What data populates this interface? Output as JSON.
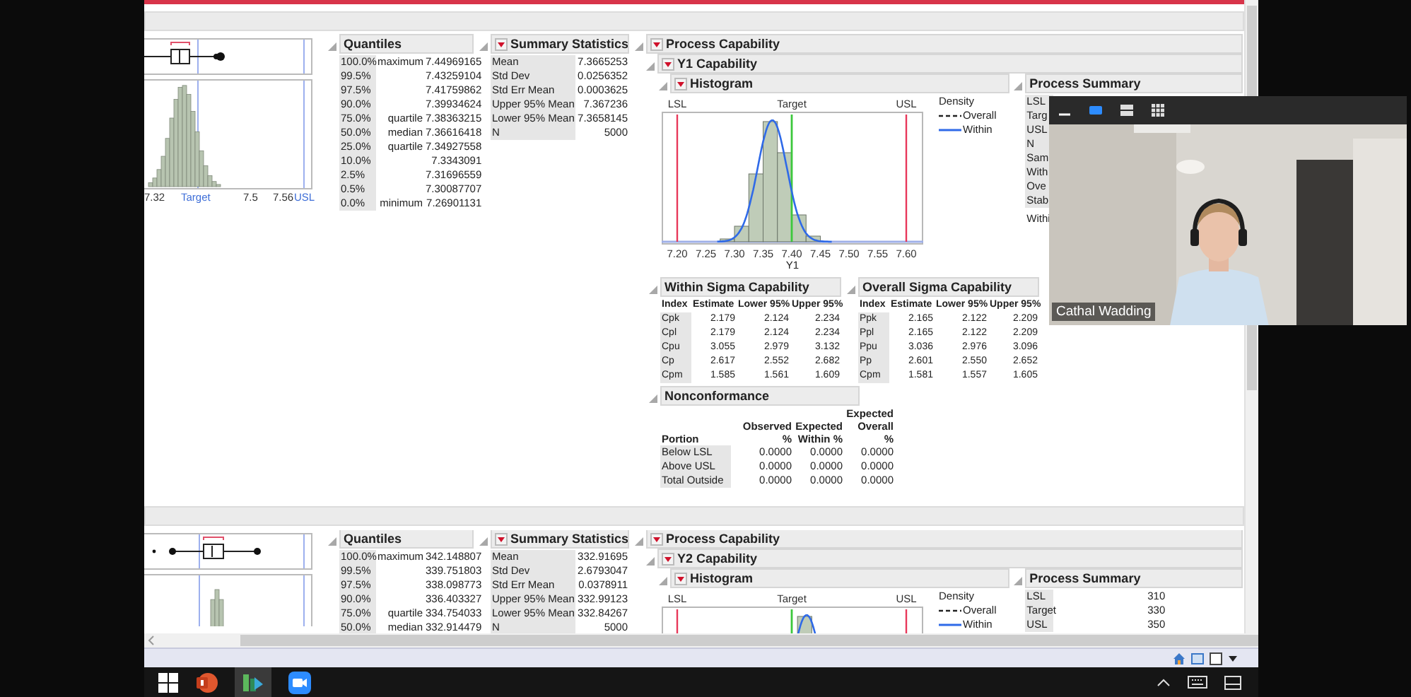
{
  "sections": [
    {
      "plot": {
        "axis_labels": [
          {
            "text": "7.32",
            "kind": "tick"
          },
          {
            "text": "Target",
            "kind": "spec"
          },
          {
            "text": "7.5",
            "kind": "tick"
          },
          {
            "text": "7.56",
            "kind": "tick"
          },
          {
            "text": "USL",
            "kind": "spec"
          }
        ]
      },
      "quantiles": {
        "title": "Quantiles",
        "rows": [
          {
            "percent": "100.0%",
            "label": "maximum",
            "value": "7.44969165"
          },
          {
            "percent": "99.5%",
            "value": "7.43259104"
          },
          {
            "percent": "97.5%",
            "value": "7.41759862"
          },
          {
            "percent": "90.0%",
            "value": "7.39934624"
          },
          {
            "percent": "75.0%",
            "label": "quartile",
            "value": "7.38363215"
          },
          {
            "percent": "50.0%",
            "label": "median",
            "value": "7.36616418"
          },
          {
            "percent": "25.0%",
            "label": "quartile",
            "value": "7.34927558"
          },
          {
            "percent": "10.0%",
            "value": "7.3343091"
          },
          {
            "percent": "2.5%",
            "value": "7.31696559"
          },
          {
            "percent": "0.5%",
            "value": "7.30087707"
          },
          {
            "percent": "0.0%",
            "label": "minimum",
            "value": "7.26901131"
          }
        ]
      },
      "summary": {
        "title": "Summary Statistics",
        "menu": true,
        "rows": [
          {
            "label": "Mean",
            "value": "7.3665253"
          },
          {
            "label": "Std Dev",
            "value": "0.0256352"
          },
          {
            "label": "Std Err Mean",
            "value": "0.0003625"
          },
          {
            "label": "Upper 95% Mean",
            "value": "7.367236"
          },
          {
            "label": "Lower 95% Mean",
            "value": "7.3658145"
          },
          {
            "label": "N",
            "value": "5000"
          }
        ]
      },
      "capability": {
        "title": "Process Capability",
        "menu": true,
        "sub": {
          "title": "Y1 Capability",
          "menu": true
        },
        "histogram": {
          "title": "Histogram",
          "menu": true,
          "spec_labels": [
            "LSL",
            "Target",
            "USL"
          ],
          "ticks": [
            "7.20",
            "7.25",
            "7.30",
            "7.35",
            "7.40",
            "7.45",
            "7.50",
            "7.55",
            "7.60"
          ],
          "xlabel": "Y1",
          "legend": {
            "title": "Density",
            "items": [
              {
                "label": "Overall",
                "kind": "dashed"
              },
              {
                "label": "Within",
                "kind": "solid"
              }
            ]
          }
        },
        "process_summary": {
          "title": "Process Summary",
          "rows": [
            {
              "label": "LSL"
            },
            {
              "label": "Targ"
            },
            {
              "label": "USL"
            },
            {
              "label": "N"
            },
            {
              "label": "Sam"
            },
            {
              "label": "With"
            },
            {
              "label": "Ove"
            },
            {
              "label": "Stab"
            }
          ],
          "note": "Withi"
        },
        "tables": [
          {
            "title": "Within Sigma Capability",
            "columns": [
              "Index",
              "Estimate",
              "Lower 95%",
              "Upper 95%"
            ],
            "rows": [
              [
                "Cpk",
                "2.179",
                "2.124",
                "2.234"
              ],
              [
                "Cpl",
                "2.179",
                "2.124",
                "2.234"
              ],
              [
                "Cpu",
                "3.055",
                "2.979",
                "3.132"
              ],
              [
                "Cp",
                "2.617",
                "2.552",
                "2.682"
              ],
              [
                "Cpm",
                "1.585",
                "1.561",
                "1.609"
              ]
            ]
          },
          {
            "title": "Overall Sigma Capability",
            "columns": [
              "Index",
              "Estimate",
              "Lower 95%",
              "Upper 95%"
            ],
            "rows": [
              [
                "Ppk",
                "2.165",
                "2.122",
                "2.209"
              ],
              [
                "Ppl",
                "2.165",
                "2.122",
                "2.209"
              ],
              [
                "Ppu",
                "3.036",
                "2.976",
                "3.096"
              ],
              [
                "Pp",
                "2.601",
                "2.550",
                "2.652"
              ],
              [
                "Cpm",
                "1.581",
                "1.557",
                "1.605"
              ]
            ]
          }
        ],
        "nonconformance": {
          "title": "Nonconformance",
          "columns": [
            "Portion",
            "Observed %",
            "Expected Within %",
            "Expected Overall %"
          ],
          "rows": [
            [
              "Below LSL",
              "0.0000",
              "0.0000",
              "0.0000"
            ],
            [
              "Above USL",
              "0.0000",
              "0.0000",
              "0.0000"
            ],
            [
              "Total Outside",
              "0.0000",
              "0.0000",
              "0.0000"
            ]
          ]
        }
      }
    },
    {
      "quantiles": {
        "title": "Quantiles",
        "rows": [
          {
            "percent": "100.0%",
            "label": "maximum",
            "value": "342.148807"
          },
          {
            "percent": "99.5%",
            "value": "339.751803"
          },
          {
            "percent": "97.5%",
            "value": "338.098773"
          },
          {
            "percent": "90.0%",
            "value": "336.403327"
          },
          {
            "percent": "75.0%",
            "label": "quartile",
            "value": "334.754033"
          },
          {
            "percent": "50.0%",
            "label": "median",
            "value": "332.914479"
          }
        ]
      },
      "summary": {
        "title": "Summary Statistics",
        "menu": true,
        "rows": [
          {
            "label": "Mean",
            "value": "332.91695"
          },
          {
            "label": "Std Dev",
            "value": "2.6793047"
          },
          {
            "label": "Std Err Mean",
            "value": "0.0378911"
          },
          {
            "label": "Upper 95% Mean",
            "value": "332.99123"
          },
          {
            "label": "Lower 95% Mean",
            "value": "332.84267"
          },
          {
            "label": "N",
            "value": "5000"
          }
        ]
      },
      "capability": {
        "title": "Process Capability",
        "menu": true,
        "sub": {
          "title": "Y2 Capability",
          "menu": true
        },
        "histogram": {
          "title": "Histogram",
          "menu": true,
          "spec_labels": [
            "LSL",
            "Target",
            "USL"
          ],
          "legend": {
            "title": "Density",
            "items": [
              {
                "label": "Overall",
                "kind": "dashed"
              },
              {
                "label": "Within",
                "kind": "solid"
              }
            ]
          }
        },
        "process_summary": {
          "title": "Process Summary",
          "rows": [
            {
              "label": "LSL",
              "value": "310"
            },
            {
              "label": "Target",
              "value": "330"
            },
            {
              "label": "USL",
              "value": "350"
            }
          ]
        }
      }
    }
  ],
  "video": {
    "name": "Cathal Wadding"
  }
}
